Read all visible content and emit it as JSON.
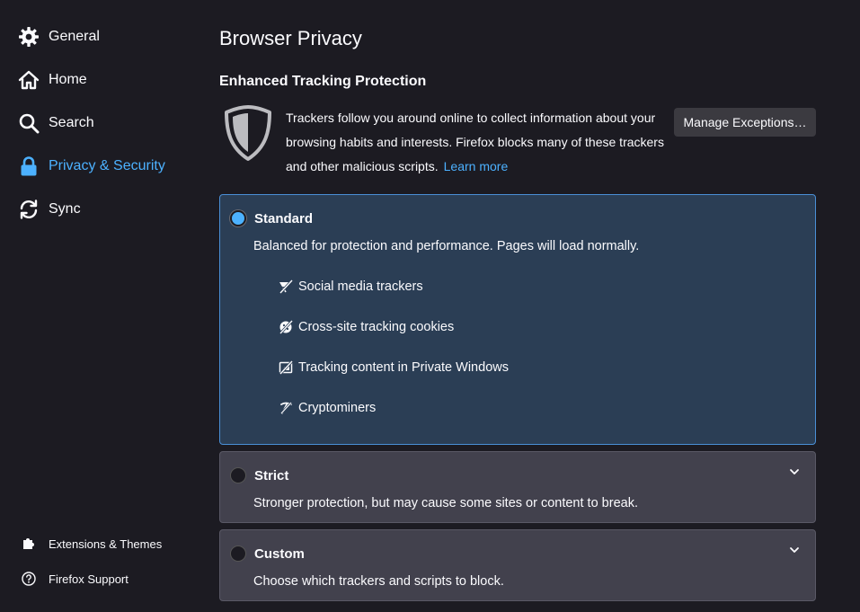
{
  "sidebar": {
    "items": [
      {
        "label": "General",
        "icon": "gear-icon"
      },
      {
        "label": "Home",
        "icon": "home-icon"
      },
      {
        "label": "Search",
        "icon": "search-icon"
      },
      {
        "label": "Privacy & Security",
        "icon": "lock-icon",
        "selected": true
      },
      {
        "label": "Sync",
        "icon": "sync-icon"
      }
    ],
    "bottom": [
      {
        "label": "Extensions & Themes",
        "icon": "puzzle-icon"
      },
      {
        "label": "Firefox Support",
        "icon": "help-icon"
      }
    ]
  },
  "main": {
    "title": "Browser Privacy",
    "section_title": "Enhanced Tracking Protection",
    "intro": "Trackers follow you around online to collect information about your browsing habits and interests. Firefox blocks many of these trackers and other malicious scripts.",
    "learn_more": "Learn more",
    "manage_exceptions": "Manage Exceptions…"
  },
  "options": {
    "standard": {
      "label": "Standard",
      "description": "Balanced for protection and performance. Pages will load normally.",
      "features": [
        {
          "label": "Social media trackers",
          "icon": "social-tracker-icon"
        },
        {
          "label": "Cross-site tracking cookies",
          "icon": "cookie-icon"
        },
        {
          "label": "Tracking content in Private Windows",
          "icon": "tracking-content-icon"
        },
        {
          "label": "Cryptominers",
          "icon": "cryptominer-icon"
        }
      ]
    },
    "strict": {
      "label": "Strict",
      "description": "Stronger protection, but may cause some sites or content to break."
    },
    "custom": {
      "label": "Custom",
      "description": "Choose which trackers and scripts to block."
    }
  },
  "colors": {
    "background": "#1c1b22",
    "accent": "#4cb1ff",
    "selected_card": "#2b3e55",
    "card": "#42414d"
  }
}
